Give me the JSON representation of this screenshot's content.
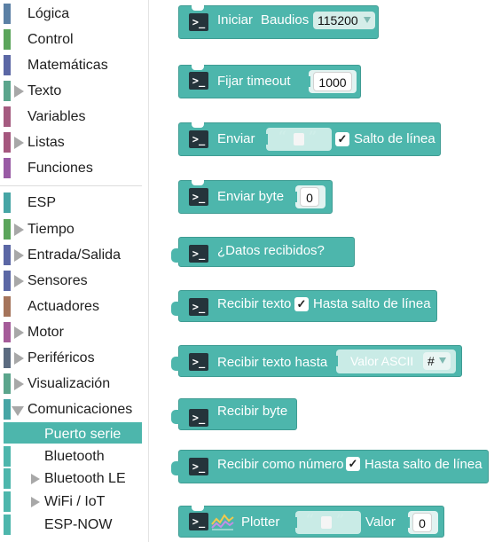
{
  "toolbox": {
    "categories": [
      {
        "label": "Lógica",
        "color": "#5b80a5"
      },
      {
        "label": "Control",
        "color": "#5ba55b"
      },
      {
        "label": "Matemáticas",
        "color": "#5b67a5"
      },
      {
        "label": "Texto",
        "color": "#5ba58c"
      },
      {
        "label": "Variables",
        "color": "#a55b80"
      },
      {
        "label": "Listas",
        "color": "#a5577e"
      },
      {
        "label": "Funciones",
        "color": "#995ba5"
      },
      {
        "label": "ESP",
        "color": "#46a5a5"
      },
      {
        "label": "Tiempo",
        "color": "#5ba55b"
      },
      {
        "label": "Entrada/Salida",
        "color": "#5b67a5"
      },
      {
        "label": "Sensores",
        "color": "#5b67a5"
      },
      {
        "label": "Actuadores",
        "color": "#a5745b"
      },
      {
        "label": "Motor",
        "color": "#a55b99"
      },
      {
        "label": "Periféricos",
        "color": "#5b6b80"
      },
      {
        "label": "Visualización",
        "color": "#5ba58c"
      },
      {
        "label": "Comunicaciones",
        "color": "#46a5a5"
      }
    ],
    "sub": [
      {
        "label": "Puerto serie",
        "color": "#4db6ac"
      },
      {
        "label": "Bluetooth",
        "color": "#4db6ac"
      },
      {
        "label": "Bluetooth LE",
        "color": "#4db6ac"
      },
      {
        "label": "WiFi / IoT",
        "color": "#4db6ac"
      },
      {
        "label": "ESP-NOW",
        "color": "#4db6ac"
      }
    ]
  },
  "blocks": {
    "iniciar": {
      "label": "Iniciar",
      "baud_label": "Baudios",
      "baud_value": "115200"
    },
    "timeout": {
      "label": "Fijar timeout",
      "value": "1000"
    },
    "enviar": {
      "label": "Enviar",
      "quote_open": "“",
      "quote_close": "”",
      "check": "✓",
      "newline_label": "Salto de línea"
    },
    "enviar_byte": {
      "label": "Enviar byte",
      "value": "0"
    },
    "datos": {
      "label": "¿Datos recibidos?"
    },
    "recibir_texto": {
      "label": "Recibir texto",
      "check": "✓",
      "until_label": "Hasta salto de línea"
    },
    "recibir_hasta": {
      "label": "Recibir texto hasta",
      "ascii_label": "Valor ASCII",
      "ascii_value": "#"
    },
    "recibir_byte": {
      "label": "Recibir byte"
    },
    "recibir_num": {
      "label": "Recibir como número",
      "check": "✓",
      "until_label": "Hasta salto de línea"
    },
    "plotter": {
      "label": "Plotter",
      "quote_open": "“",
      "quote_close": "”",
      "value_label": "Valor",
      "value": "0"
    }
  },
  "colors": {
    "block": "#4db6ac",
    "selected": "#4db6ac",
    "dark_icon": "#25343b"
  },
  "icons": {
    "terminal": "terminal-icon",
    "plotter": "chart-icon",
    "expand": "triangle-right-icon",
    "expanded": "triangle-down-icon"
  }
}
